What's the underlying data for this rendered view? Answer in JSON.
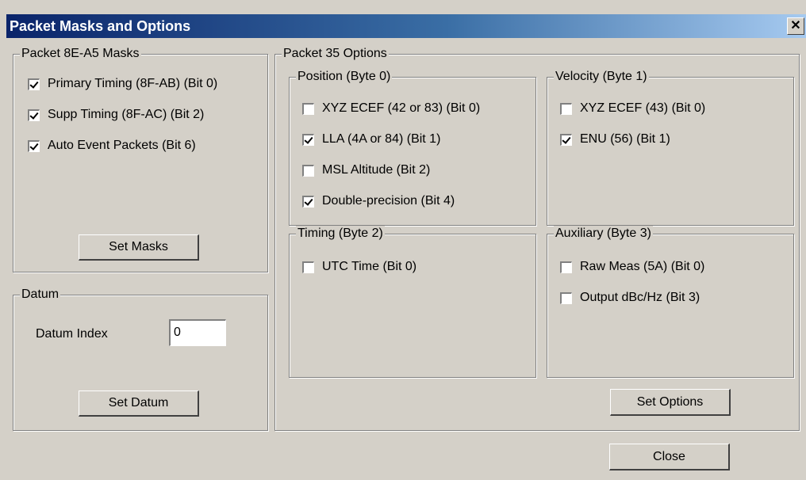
{
  "window": {
    "title": "Packet Masks and Options",
    "close_glyph": "✕"
  },
  "masks": {
    "legend": "Packet 8E-A5 Masks",
    "items": [
      {
        "label": "Primary Timing (8F-AB) (Bit 0)",
        "checked": true
      },
      {
        "label": "Supp Timing (8F-AC) (Bit 2)",
        "checked": true
      },
      {
        "label": "Auto Event Packets (Bit 6)",
        "checked": true
      }
    ],
    "button": "Set Masks"
  },
  "datum": {
    "legend": "Datum",
    "index_label": "Datum Index",
    "index_value": "0",
    "button": "Set Datum"
  },
  "options": {
    "legend": "Packet 35 Options",
    "position": {
      "legend": "Position (Byte 0)",
      "items": [
        {
          "label": "XYZ ECEF (42 or 83) (Bit 0)",
          "checked": false
        },
        {
          "label": "LLA (4A or 84) (Bit 1)",
          "checked": true
        },
        {
          "label": "MSL Altitude (Bit 2)",
          "checked": false
        },
        {
          "label": "Double-precision (Bit 4)",
          "checked": true
        }
      ]
    },
    "velocity": {
      "legend": "Velocity (Byte 1)",
      "items": [
        {
          "label": "XYZ ECEF (43) (Bit 0)",
          "checked": false
        },
        {
          "label": "ENU (56) (Bit 1)",
          "checked": true
        }
      ]
    },
    "timing": {
      "legend": "Timing (Byte 2)",
      "items": [
        {
          "label": "UTC Time (Bit 0)",
          "checked": false
        }
      ]
    },
    "auxiliary": {
      "legend": "Auxiliary (Byte 3)",
      "items": [
        {
          "label": "Raw Meas (5A) (Bit 0)",
          "checked": false
        },
        {
          "label": "Output dBc/Hz (Bit 3)",
          "checked": false
        }
      ]
    },
    "button": "Set Options"
  },
  "footer": {
    "close_button": "Close"
  }
}
